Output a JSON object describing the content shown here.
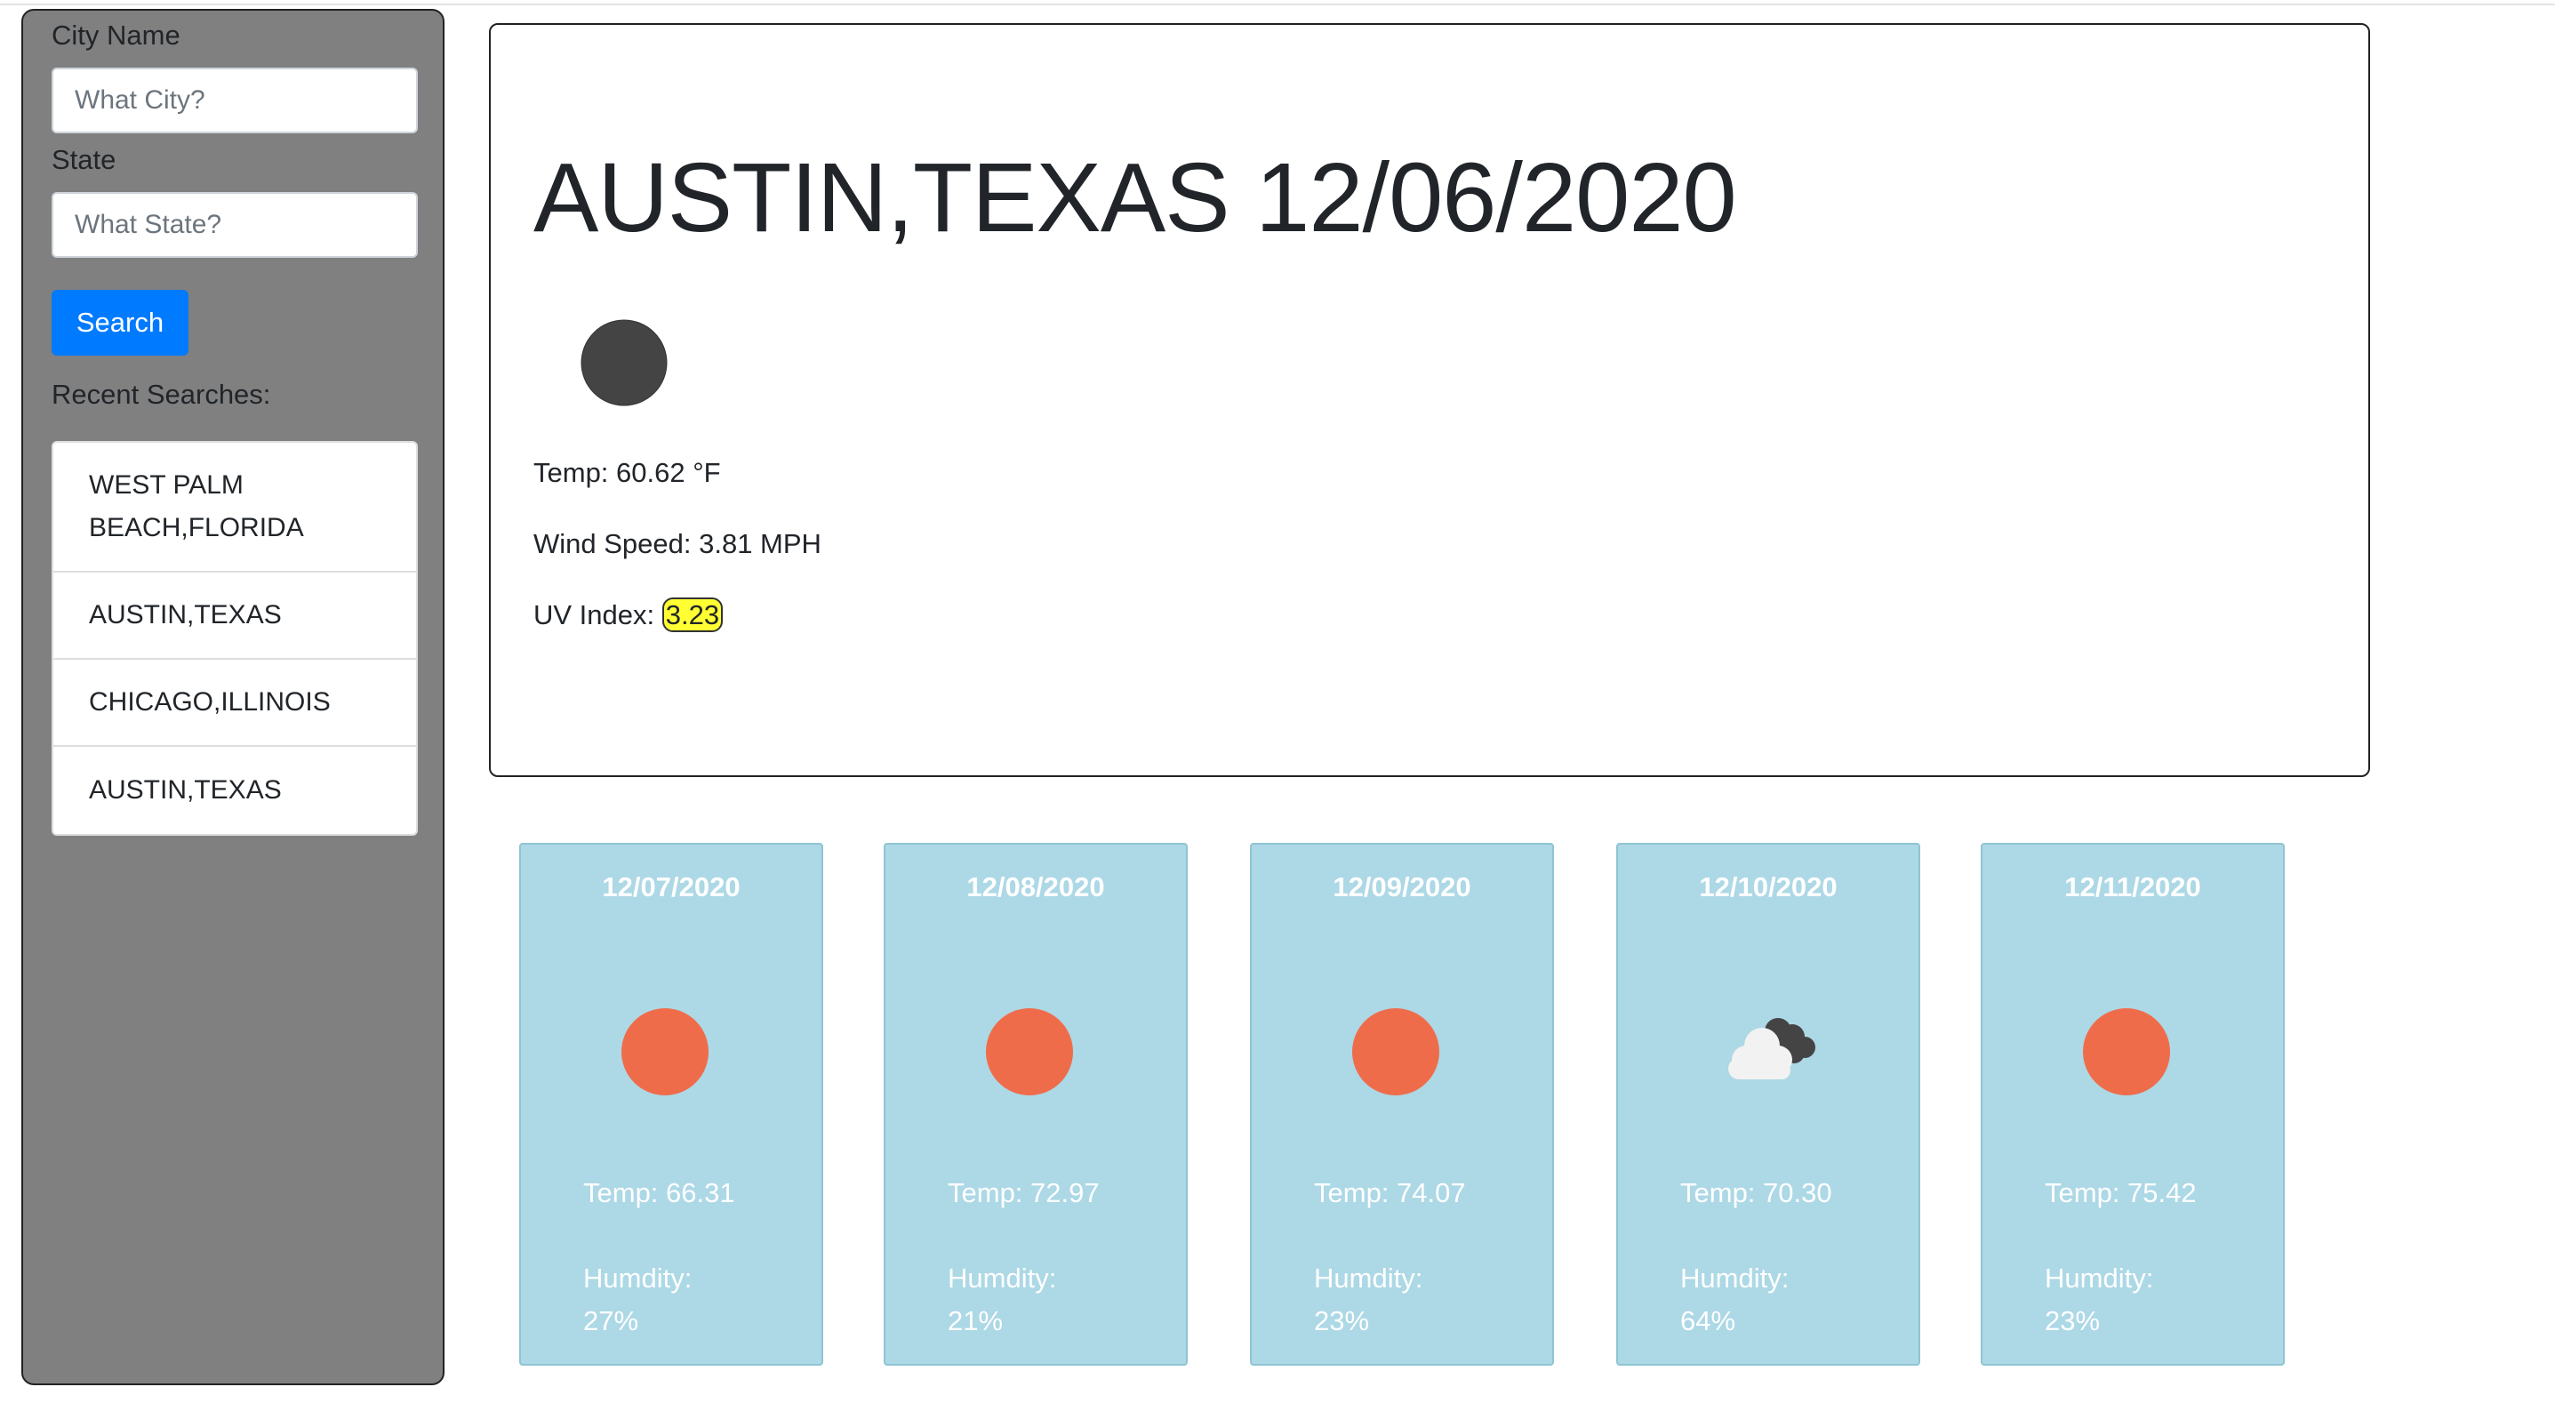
{
  "search": {
    "city_label": "City Name",
    "city_placeholder": "What City?",
    "city_value": "",
    "state_label": "State",
    "state_placeholder": "What State?",
    "state_value": "",
    "button_label": "Search",
    "recent_label": "Recent Searches:",
    "recent": [
      {
        "line1": "WEST PALM",
        "line2": "BEACH,FLORIDA"
      },
      {
        "line1": "AUSTIN,TEXAS"
      },
      {
        "line1": "CHICAGO,ILLINOIS"
      },
      {
        "line1": "AUSTIN,TEXAS"
      }
    ]
  },
  "current": {
    "title": "AUSTIN,TEXAS 12/06/2020",
    "icon": "moon-clear-icon",
    "temp": "Temp: 60.62 °F",
    "wind": "Wind Speed: 3.81 MPH",
    "uv_label": "UV Index: ",
    "uv_value": "3.23",
    "uv_color": "#ffff33"
  },
  "forecast": [
    {
      "date": "12/07/2020",
      "icon": "sun-icon",
      "temp": "Temp: 66.31",
      "humidity_label": "Humdity:",
      "humidity_value": "27%"
    },
    {
      "date": "12/08/2020",
      "icon": "sun-icon",
      "temp": "Temp: 72.97",
      "humidity_label": "Humdity:",
      "humidity_value": "21%"
    },
    {
      "date": "12/09/2020",
      "icon": "sun-icon",
      "temp": "Temp: 74.07",
      "humidity_label": "Humdity:",
      "humidity_value": "23%"
    },
    {
      "date": "12/10/2020",
      "icon": "clouds-icon",
      "temp": "Temp: 70.30",
      "humidity_label": "Humdity:",
      "humidity_value": "64%"
    },
    {
      "date": "12/11/2020",
      "icon": "sun-icon",
      "temp": "Temp: 75.42",
      "humidity_label": "Humdity:",
      "humidity_value": "23%"
    }
  ],
  "colors": {
    "sidebar_bg": "#808080",
    "button": "#007bff",
    "forecast_card": "#add8e6",
    "sun": "#ef6c4a",
    "moon": "#444444"
  }
}
